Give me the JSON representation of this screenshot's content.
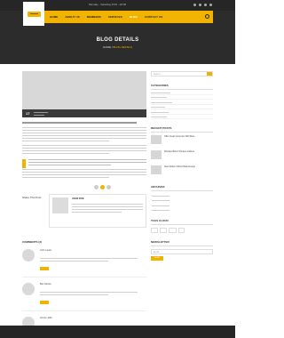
{
  "header": {
    "contact_phone": "",
    "contact_hours": "Monday - Saturday 8:00 - 18:00",
    "nav": [
      "HOME",
      "ABOUT US",
      "MEMBERS",
      "SERVICES",
      "BLOG",
      "CONTACT US"
    ],
    "active_nav_index": 4
  },
  "hero": {
    "title": "BLOG DETAILS",
    "breadcrumb_home": "HOME",
    "breadcrumb_current": "BLOG DETAILS"
  },
  "post": {
    "date_day": "17",
    "date_month": "",
    "meta_author": "",
    "meta_category": ""
  },
  "share": {
    "label": "Share This Post"
  },
  "author": {
    "name": "JOHN DOE"
  },
  "comments": {
    "title": "COMMENTS (3)",
    "items": [
      {
        "name": "John Lewis",
        "date": ""
      },
      {
        "name": "Ben Moore",
        "date": ""
      },
      {
        "name": "Jennie Jello",
        "date": ""
      }
    ]
  },
  "sidebar": {
    "search_placeholder": "Search...",
    "categories_title": "CATEGORIES",
    "categories": [
      "",
      "",
      "",
      "",
      "",
      "",
      "",
      ""
    ],
    "recent_title": "RECENT POSTS",
    "recent": [
      {
        "title": "Offer Great Computer With Best...",
        "date": ""
      },
      {
        "title": "Wooden Barrel Shelves Cabinet",
        "date": ""
      },
      {
        "title": "New Modern Wood Table Design",
        "date": ""
      }
    ],
    "archives_title": "ARCHIVES",
    "archives": [
      "",
      "",
      "",
      "",
      ""
    ],
    "tags_title": "TAGS CLOUD",
    "tags": [
      "",
      "",
      "",
      "",
      "",
      "",
      "",
      ""
    ],
    "newsletter_title": "NEWSLETTER",
    "newsletter_placeholder": "Email",
    "newsletter_button": "SEND"
  },
  "colors": {
    "accent": "#f2b200",
    "dark": "#262626"
  }
}
